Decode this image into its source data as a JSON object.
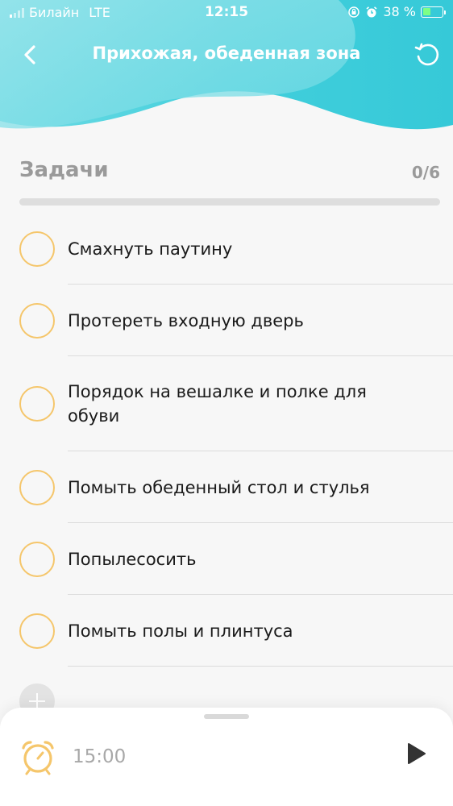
{
  "status_bar": {
    "carrier": "Билайн",
    "network": "LTE",
    "time": "12:15",
    "battery_percent": "38 %",
    "battery_level": 0.38
  },
  "header": {
    "title": "Прихожая, обеденная зона",
    "back_icon": "chevron-left-icon",
    "reset_icon": "reset-icon"
  },
  "tasks_section": {
    "title": "Задачи",
    "count": "0/6",
    "progress": 0,
    "items": [
      {
        "label": "Смахнуть паутину",
        "done": false
      },
      {
        "label": "Протереть входную дверь",
        "done": false
      },
      {
        "label": "Порядок на вешалке и полке для обуви",
        "done": false
      },
      {
        "label": "Помыть обеденный стол и стулья",
        "done": false
      },
      {
        "label": "Попылесосить",
        "done": false
      },
      {
        "label": "Помыть полы и плинтуса",
        "done": false
      }
    ]
  },
  "timer": {
    "value": "15:00",
    "alarm_icon": "alarm-clock-icon",
    "play_icon": "play-icon"
  },
  "colors": {
    "accent": "#f5c66b",
    "header_teal": "#3fd0dc",
    "header_light": "#8ae4ea",
    "text_muted": "#9a9a9a"
  }
}
